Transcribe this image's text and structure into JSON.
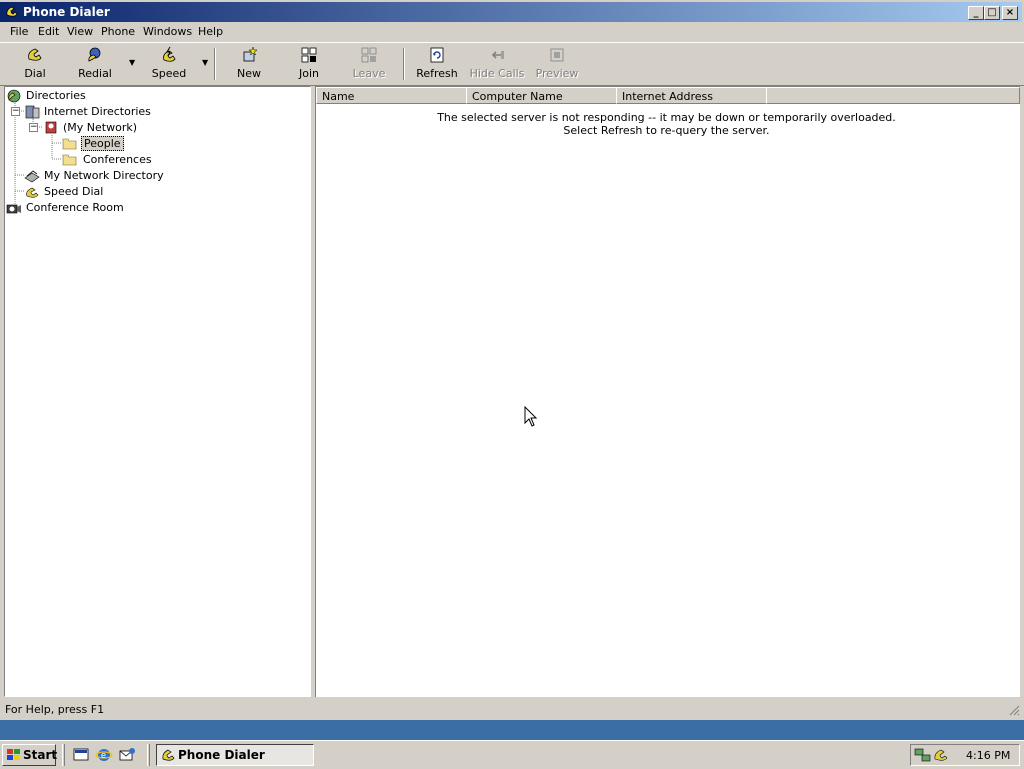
{
  "window": {
    "title": "Phone Dialer"
  },
  "menu": [
    "File",
    "Edit",
    "View",
    "Phone",
    "Windows",
    "Help"
  ],
  "toolbar": {
    "dial": "Dial",
    "redial": "Redial",
    "speed": "Speed",
    "new": "New",
    "join": "Join",
    "leave": "Leave",
    "refresh": "Refresh",
    "hide_calls": "Hide Calls",
    "preview": "Preview"
  },
  "tree": {
    "directories": "Directories",
    "internet_directories": "Internet Directories",
    "my_network": "(My Network)",
    "people": "People",
    "conferences": "Conferences",
    "my_network_directory": "My Network Directory",
    "speed_dial": "Speed Dial",
    "conference_room": "Conference Room"
  },
  "list": {
    "columns": [
      "Name",
      "Computer Name",
      "Internet Address"
    ],
    "message_line1": "The selected server is not responding -- it may be down or temporarily overloaded.",
    "message_line2": "Select Refresh to re-query the server."
  },
  "statusbar": {
    "text": "For Help, press F1"
  },
  "taskbar": {
    "start": "Start",
    "task": "Phone Dialer",
    "clock": "4:16 PM"
  },
  "colors": {
    "titlebar_start": "#0a246a",
    "titlebar_end": "#a6caf0",
    "desktop": "#3a6ea5",
    "chrome": "#d4d0c8"
  }
}
